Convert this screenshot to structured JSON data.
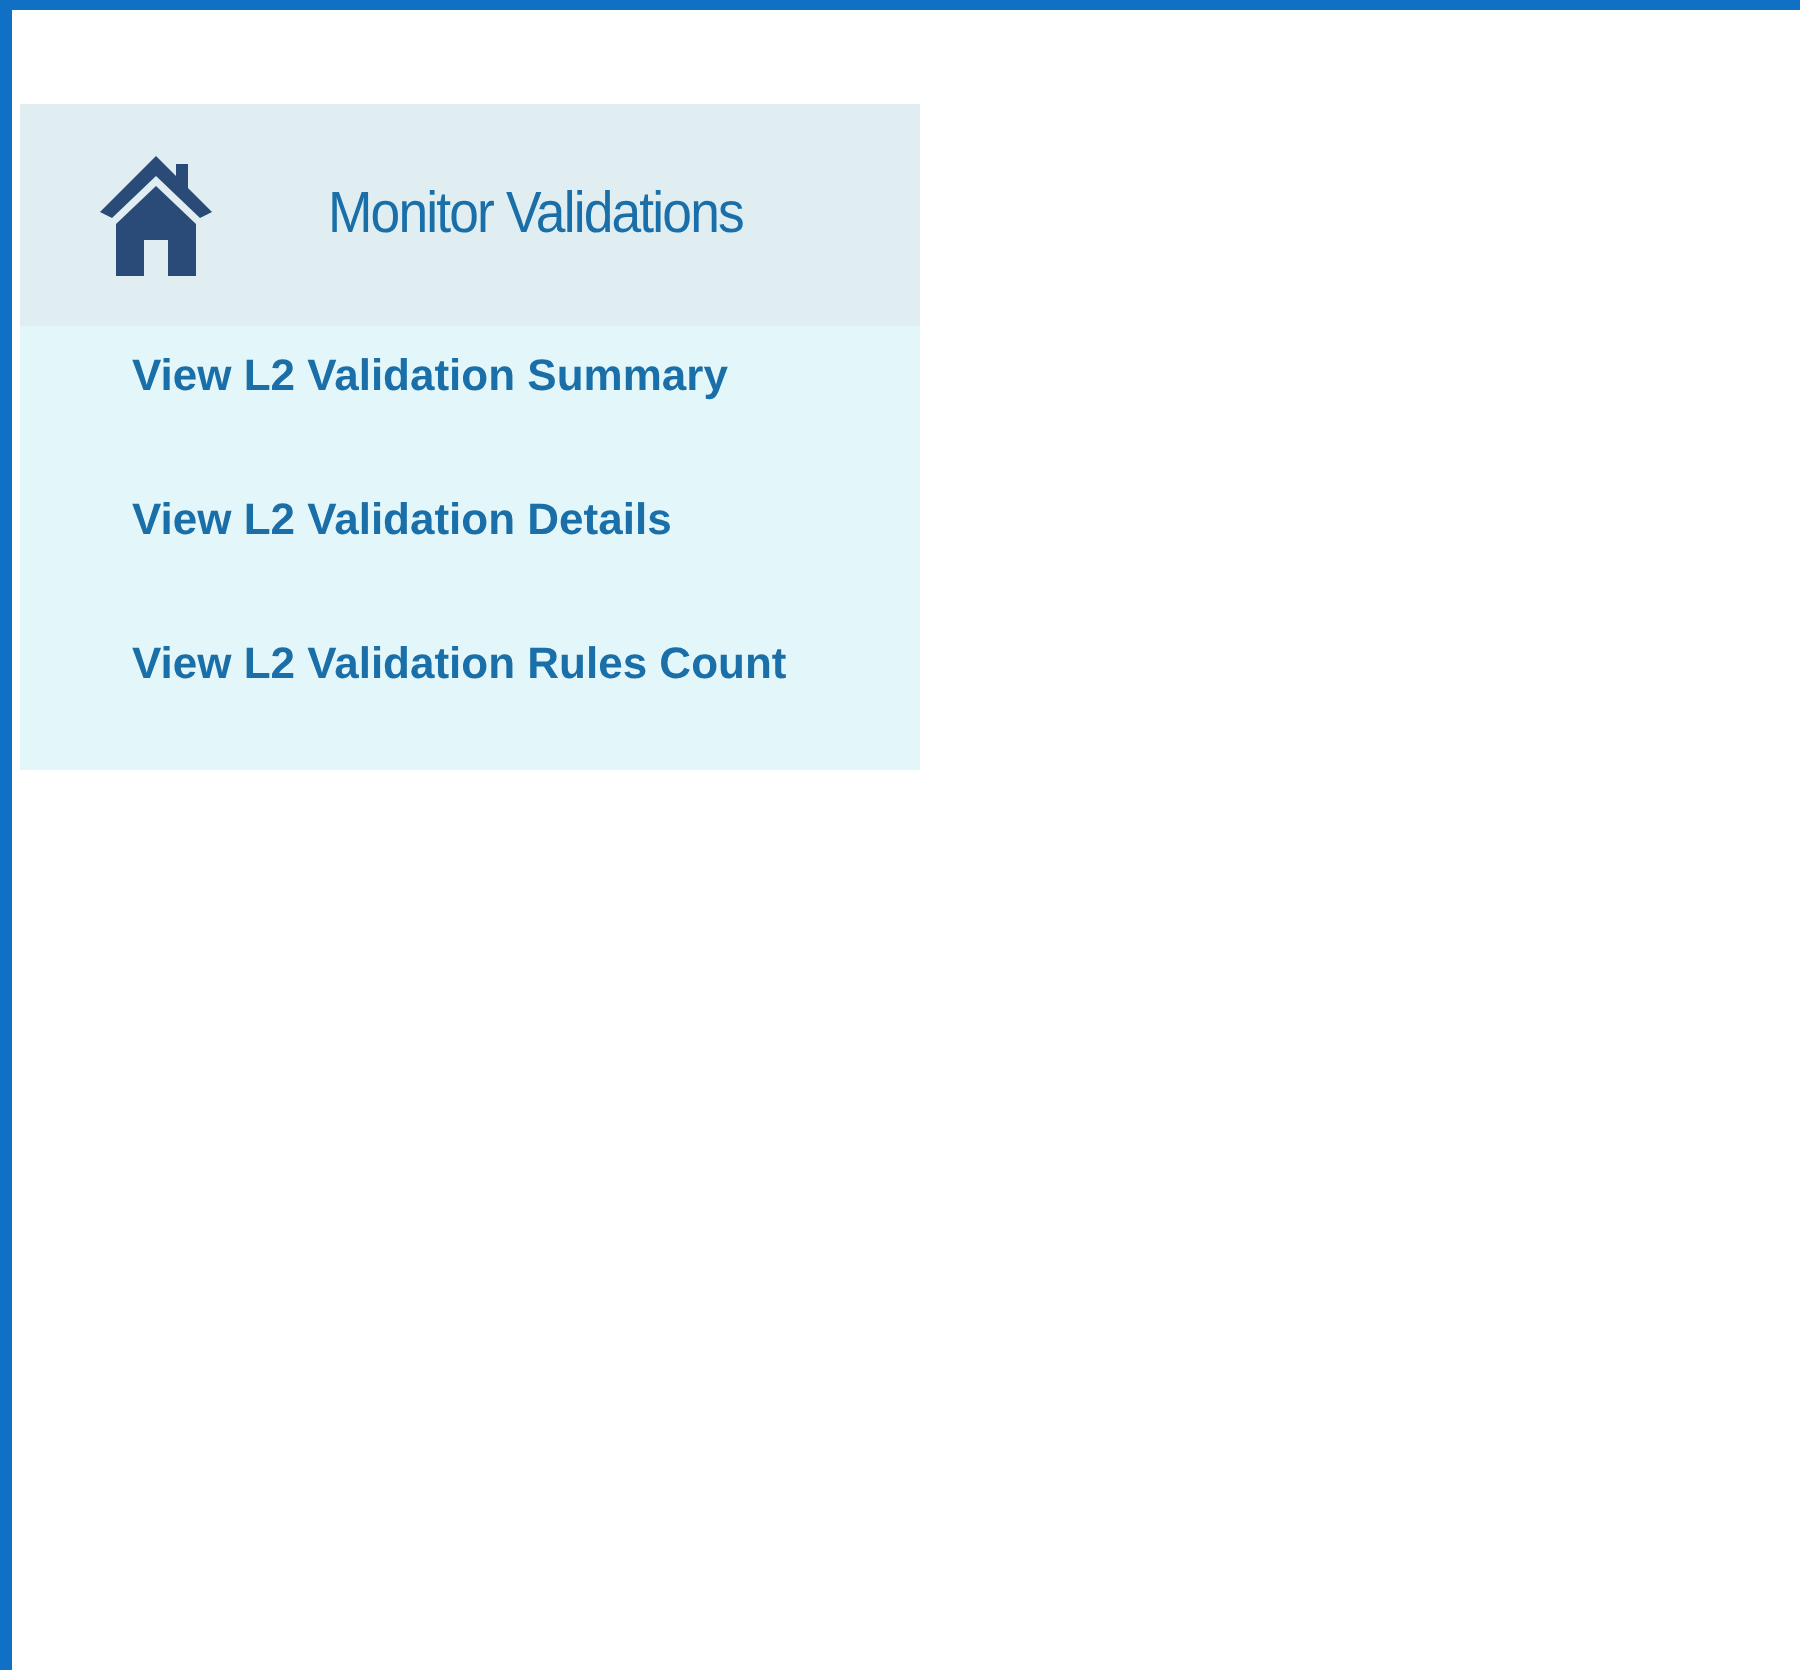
{
  "menu": {
    "title": "Monitor Validations",
    "items": [
      {
        "label": "View L2 Validation Summary"
      },
      {
        "label": "View L2 Validation Details"
      },
      {
        "label": "View L2 Validation Rules Count"
      }
    ]
  }
}
